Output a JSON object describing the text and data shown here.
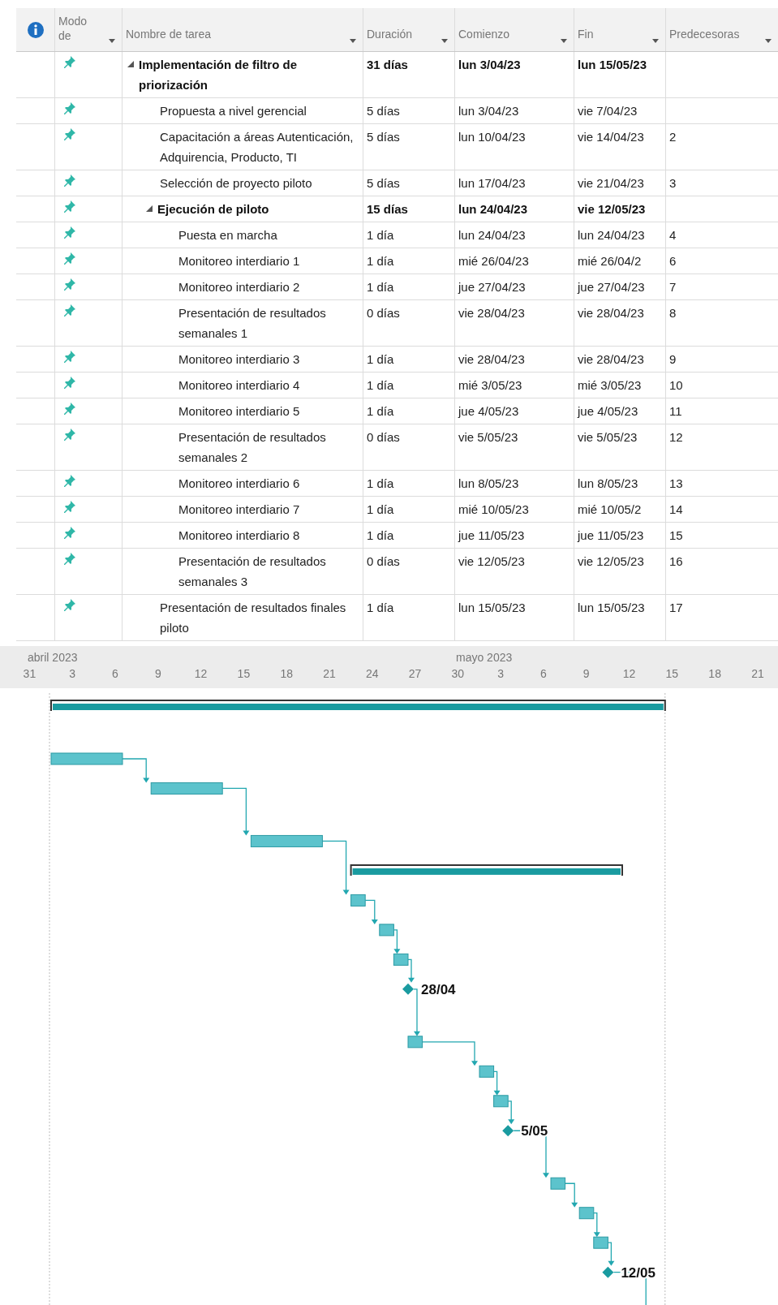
{
  "table": {
    "columns": [
      {
        "label": "Modo de"
      },
      {
        "label": "Nombre de tarea"
      },
      {
        "label": "Duración"
      },
      {
        "label": "Comienzo"
      },
      {
        "label": "Fin"
      },
      {
        "label": "Predecesoras"
      }
    ],
    "rows": [
      {
        "kind": "summary",
        "expanded": true,
        "name": "Implementación de filtro de priorización",
        "duration": "31 días",
        "start": "lun 3/04/23",
        "finish": "lun 15/05/23",
        "children": [
          {
            "kind": "task",
            "name": "Propuesta a nivel gerencial",
            "duration": "5 días",
            "start": "lun 3/04/23",
            "finish": "vie 7/04/23"
          },
          {
            "kind": "task",
            "name": "Capacitación a áreas Autenticación, Adquirencia, Producto, TI",
            "duration": "5 días",
            "start": "lun 10/04/23",
            "finish": "vie 14/04/23",
            "predecessors": "2"
          },
          {
            "kind": "task",
            "name": "Selección de proyecto piloto",
            "duration": "5 días",
            "start": "lun 17/04/23",
            "finish": "vie 21/04/23",
            "predecessors": "3"
          },
          {
            "kind": "summary",
            "expanded": true,
            "name": "Ejecución de piloto",
            "duration": "15 días",
            "start": "lun 24/04/23",
            "finish": "vie 12/05/23",
            "children": [
              {
                "kind": "task",
                "name": "Puesta en marcha",
                "duration": "1 día",
                "start": "lun 24/04/23",
                "finish": "lun 24/04/23",
                "predecessors": "4"
              },
              {
                "kind": "task",
                "name": "Monitoreo interdiario 1",
                "duration": "1 día",
                "start": "mié 26/04/23",
                "finish": "mié 26/04/2",
                "predecessors": "6"
              },
              {
                "kind": "task",
                "name": "Monitoreo interdiario 2",
                "duration": "1 día",
                "start": "jue 27/04/23",
                "finish": "jue 27/04/23",
                "predecessors": "7"
              },
              {
                "kind": "milestone",
                "name": "Presentación de resultados semanales 1",
                "duration": "0 días",
                "start": "vie 28/04/23",
                "finish": "vie 28/04/23",
                "predecessors": "8",
                "gantt_label": "28/04"
              },
              {
                "kind": "task",
                "name": "Monitoreo interdiario 3",
                "duration": "1 día",
                "start": "vie 28/04/23",
                "finish": "vie 28/04/23",
                "predecessors": "9"
              },
              {
                "kind": "task",
                "name": "Monitoreo interdiario 4",
                "duration": "1 día",
                "start": "mié 3/05/23",
                "finish": "mié 3/05/23",
                "predecessors": "10"
              },
              {
                "kind": "task",
                "name": "Monitoreo interdiario 5",
                "duration": "1 día",
                "start": "jue 4/05/23",
                "finish": "jue 4/05/23",
                "predecessors": "11"
              },
              {
                "kind": "milestone",
                "name": "Presentación de resultados semanales 2",
                "duration": "0 días",
                "start": "vie 5/05/23",
                "finish": "vie 5/05/23",
                "predecessors": "12",
                "gantt_label": "5/05"
              },
              {
                "kind": "task",
                "name": "Monitoreo interdiario 6",
                "duration": "1 día",
                "start": "lun 8/05/23",
                "finish": "lun 8/05/23",
                "predecessors": "13"
              },
              {
                "kind": "task",
                "name": "Monitoreo interdiario 7",
                "duration": "1 día",
                "start": "mié 10/05/23",
                "finish": "mié 10/05/2",
                "predecessors": "14"
              },
              {
                "kind": "task",
                "name": "Monitoreo interdiario 8",
                "duration": "1 día",
                "start": "jue 11/05/23",
                "finish": "jue 11/05/23",
                "predecessors": "15"
              },
              {
                "kind": "milestone",
                "name": "Presentación de resultados semanales 3",
                "duration": "0 días",
                "start": "vie 12/05/23",
                "finish": "vie 12/05/23",
                "predecessors": "16",
                "gantt_label": "12/05"
              }
            ]
          },
          {
            "kind": "task",
            "name": "Presentación de resultados finales piloto",
            "duration": "1 día",
            "start": "lun 15/05/23",
            "finish": "lun 15/05/23",
            "predecessors": "17"
          }
        ]
      }
    ]
  },
  "timescale": {
    "months": [
      "abril 2023",
      "mayo 2023"
    ],
    "ticks": [
      "31",
      "3",
      "6",
      "9",
      "12",
      "15",
      "18",
      "21",
      "24",
      "27",
      "30",
      "3",
      "6",
      "9",
      "12",
      "15",
      "18",
      "21"
    ]
  }
}
